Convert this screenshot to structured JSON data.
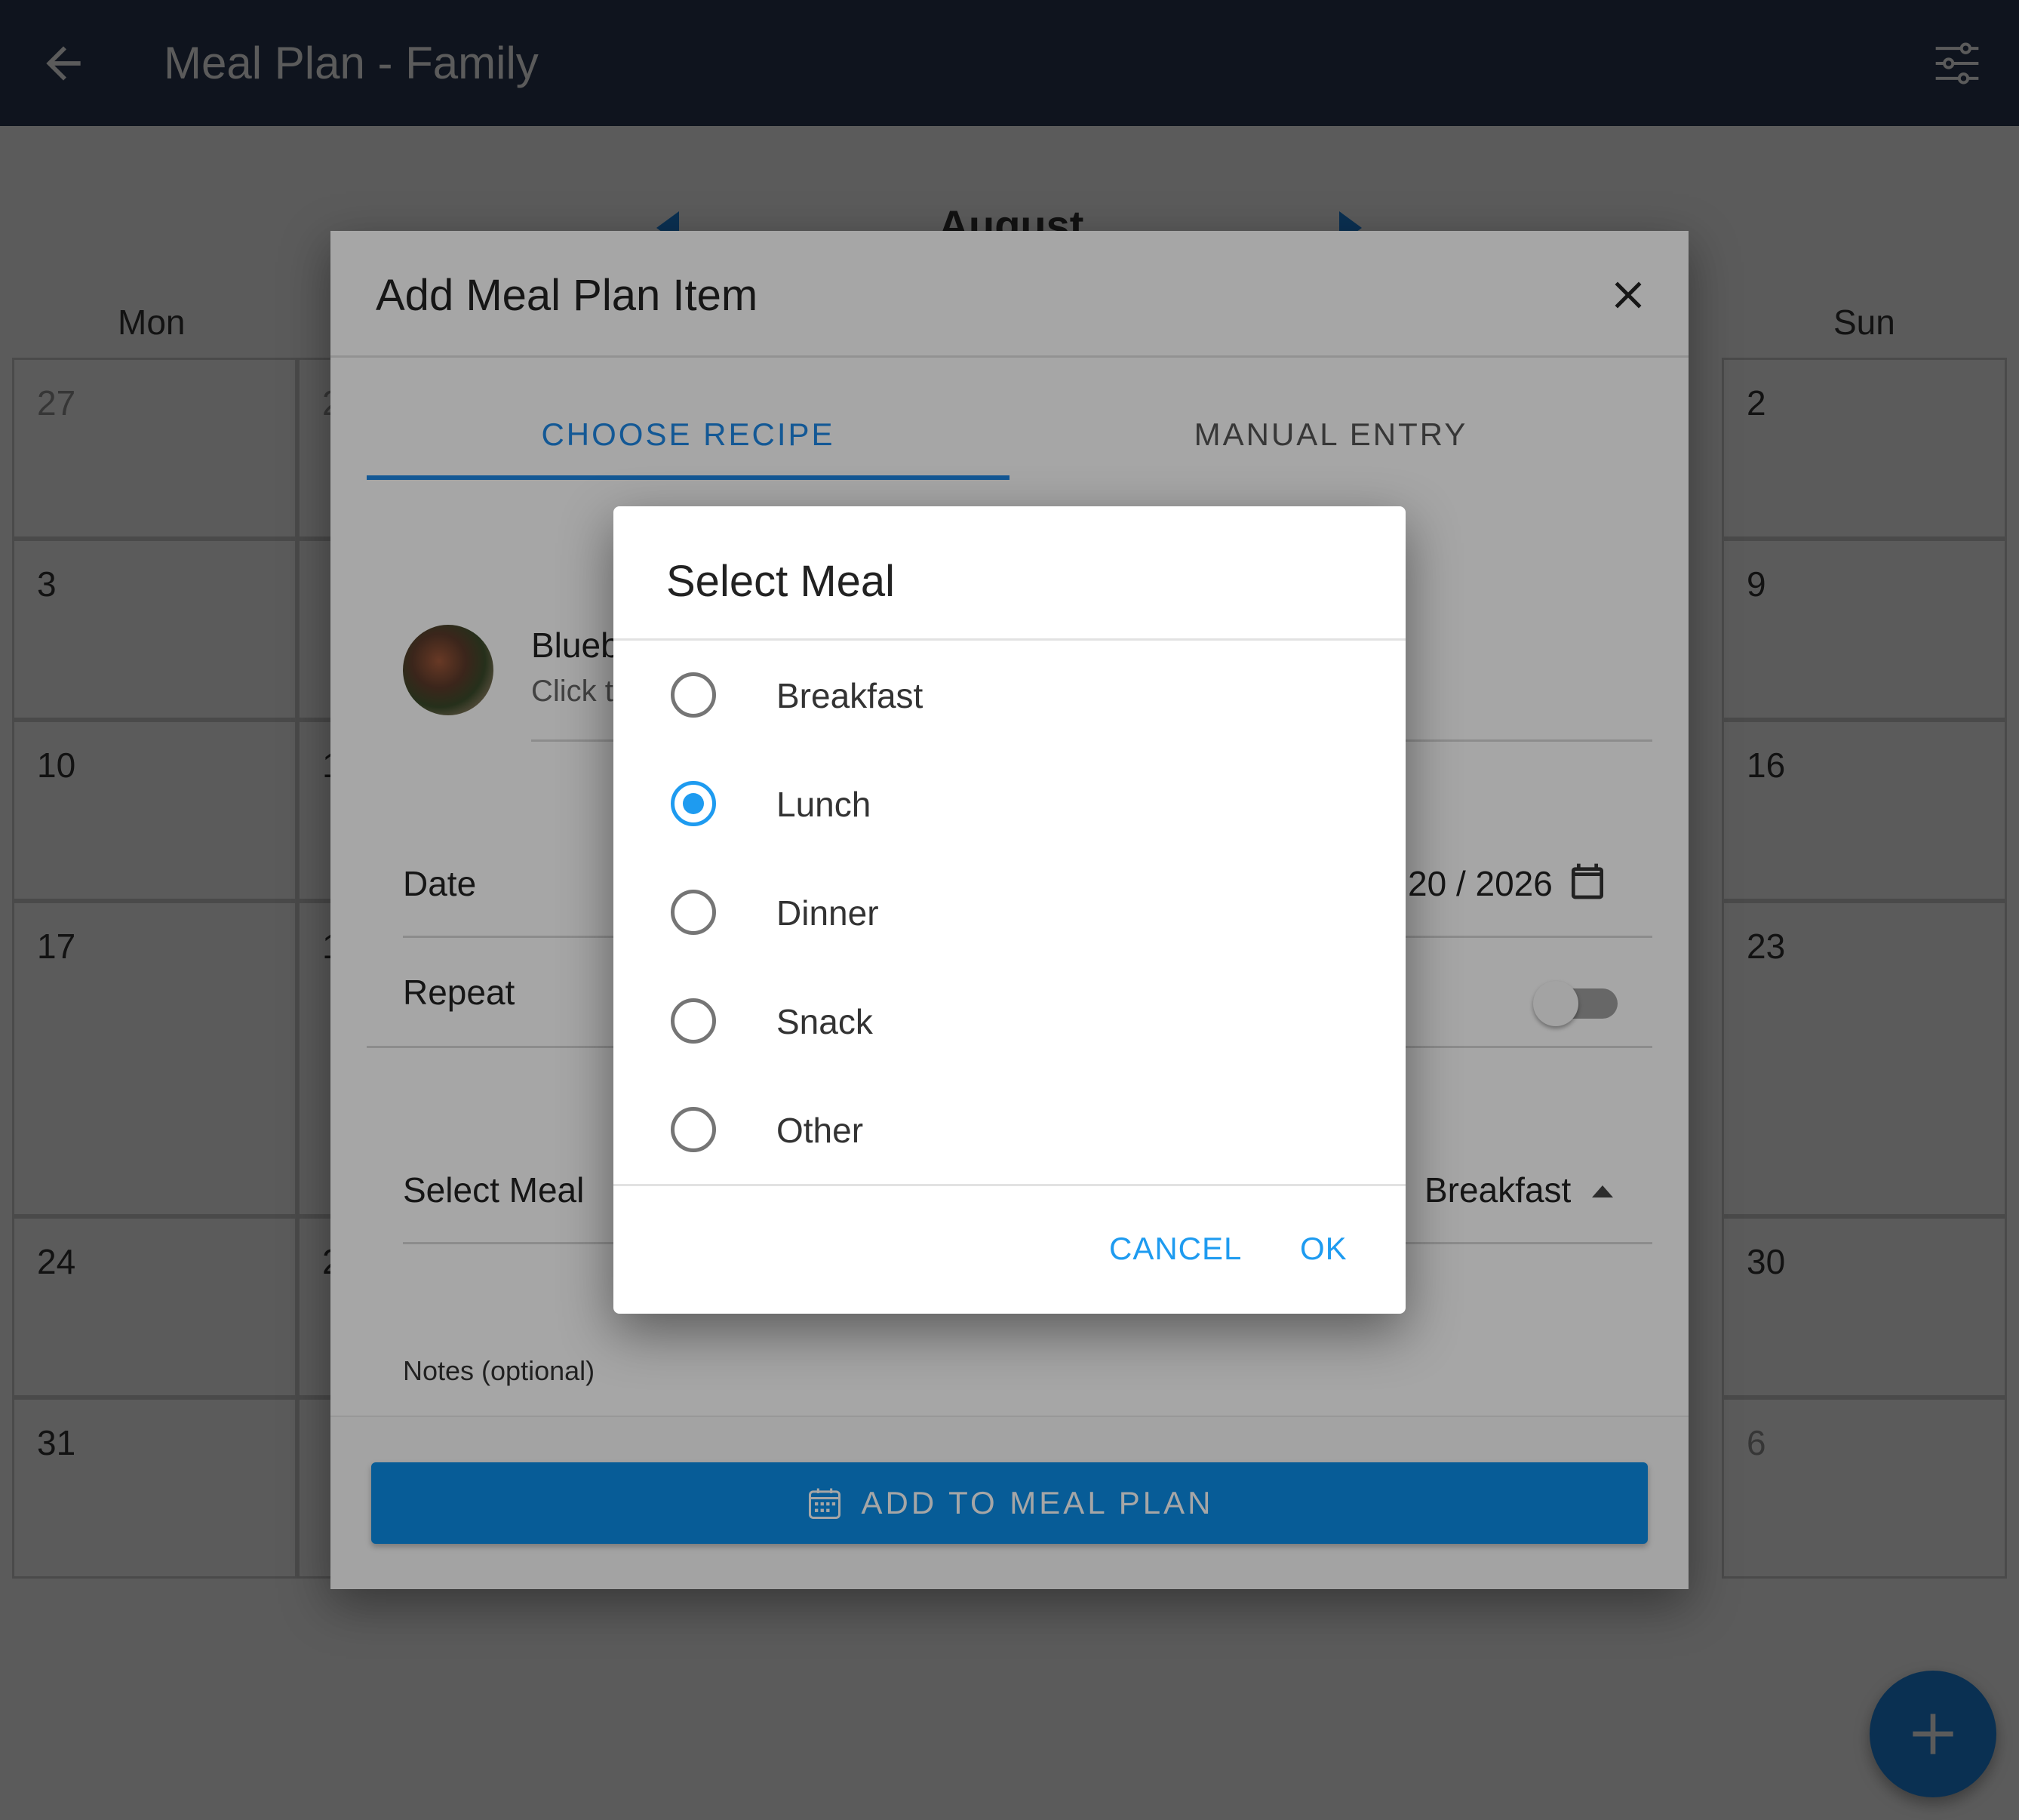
{
  "appbar": {
    "title": "Meal Plan - Family",
    "back_icon": "arrow-left-icon",
    "settings_icon": "tune-icon",
    "background": "#2b3a55"
  },
  "calendar": {
    "month": "August",
    "weekdays": [
      "Mon",
      "Sun"
    ],
    "mon_dates": [
      "27",
      "3",
      "10",
      "17",
      "24",
      "31"
    ],
    "sun_dates": [
      "2",
      "9",
      "16",
      "23",
      "30",
      "6"
    ],
    "tue_partial": [
      "2",
      "",
      "1",
      "1",
      "2",
      ""
    ]
  },
  "dialog": {
    "title": "Add Meal Plan Item",
    "close_icon": "close-icon",
    "tabs": [
      "CHOOSE RECIPE",
      "MANUAL ENTRY"
    ],
    "active_tab": 0,
    "recipe": {
      "title": "Blueb",
      "subtitle": "Click t"
    },
    "date_label": "Date",
    "date_value": "20 / 2026",
    "calendar_icon": "calendar-icon",
    "repeat_label": "Repeat",
    "repeat_on": false,
    "meal_label": "Select Meal",
    "meal_value": "Breakfast",
    "notes_label": "Notes (optional)",
    "add_button": "ADD TO MEAL PLAN",
    "accent": "#1e88e5"
  },
  "select_meal": {
    "title": "Select Meal",
    "options": [
      "Breakfast",
      "Lunch",
      "Dinner",
      "Snack",
      "Other"
    ],
    "selected": "Lunch",
    "cancel": "CANCEL",
    "ok": "OK",
    "accent": "#1e9bf0"
  },
  "fab": {
    "icon": "plus-icon"
  }
}
